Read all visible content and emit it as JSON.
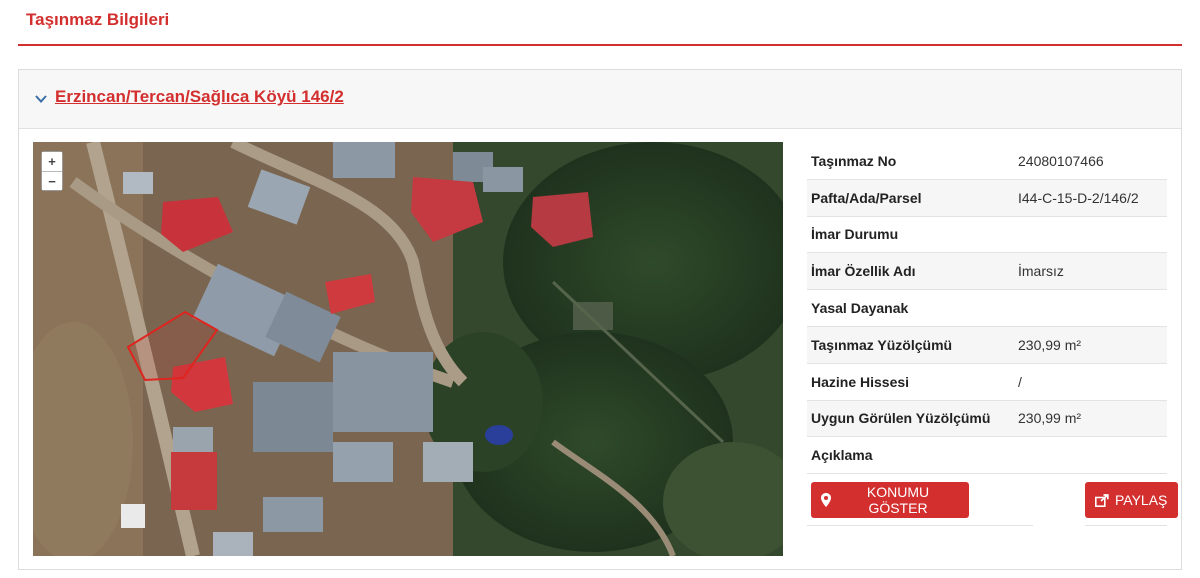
{
  "page": {
    "title": "Taşınmaz Bilgileri"
  },
  "property": {
    "title": "Erzincan/Tercan/Sağlıca Köyü 146/2"
  },
  "map": {
    "zoom_in": "+",
    "zoom_out": "−"
  },
  "details": [
    {
      "label": "Taşınmaz No",
      "value": "24080107466"
    },
    {
      "label": "Pafta/Ada/Parsel",
      "value": "I44-C-15-D-2/146/2"
    },
    {
      "label": "İmar Durumu",
      "value": ""
    },
    {
      "label": "İmar Özellik Adı",
      "value": "İmarsız"
    },
    {
      "label": "Yasal Dayanak",
      "value": ""
    },
    {
      "label": "Taşınmaz Yüzölçümü",
      "value": "230,99 m²"
    },
    {
      "label": "Hazine Hissesi",
      "value": "/"
    },
    {
      "label": "Uygun Görülen Yüzölçümü",
      "value": "230,99 m²"
    },
    {
      "label": "Açıklama",
      "value": ""
    }
  ],
  "actions": {
    "show_location": "KONUMU GÖSTER",
    "share": "PAYLAŞ"
  },
  "colors": {
    "accent": "#d32f2f"
  }
}
